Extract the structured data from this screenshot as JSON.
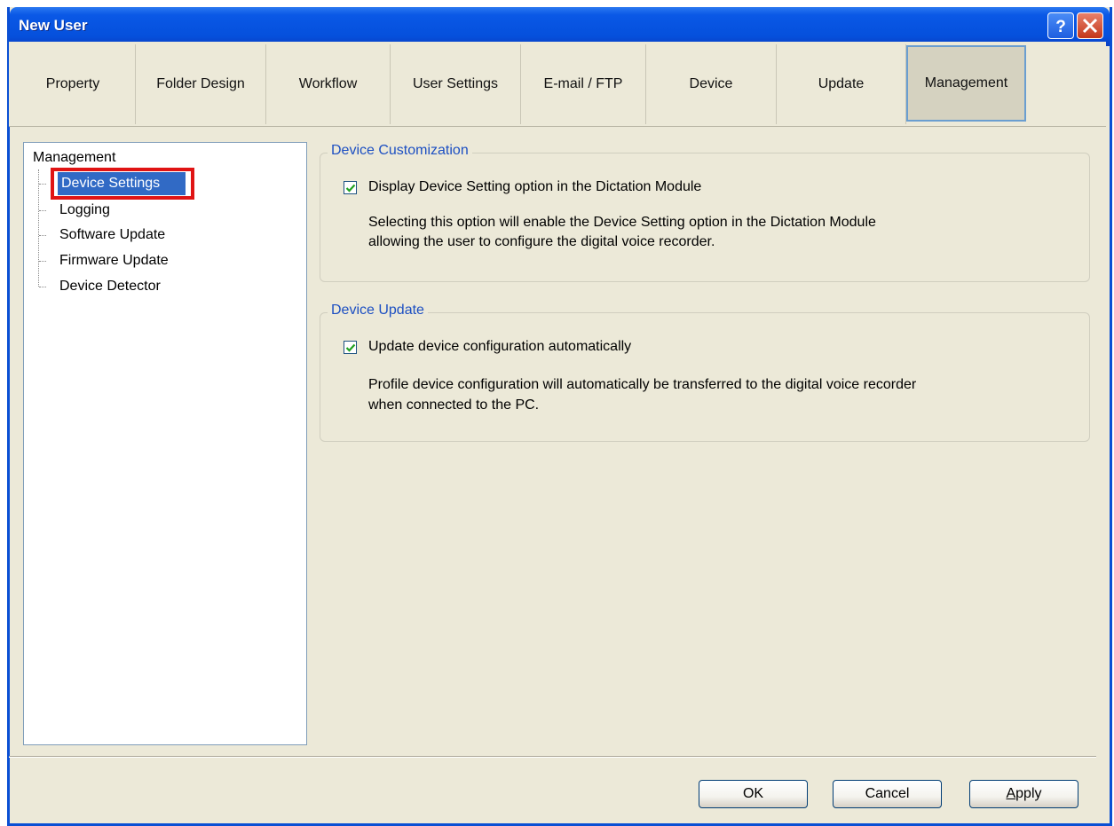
{
  "window": {
    "title": "New User",
    "help_label": "?",
    "close_label": "X"
  },
  "tabs": [
    {
      "label": "Property"
    },
    {
      "label": "Folder Design"
    },
    {
      "label": "Workflow"
    },
    {
      "label": "User Settings"
    },
    {
      "label": "E-mail / FTP"
    },
    {
      "label": "Device"
    },
    {
      "label": "Update"
    },
    {
      "label": "Management",
      "active": true
    }
  ],
  "tree": {
    "root": "Management",
    "items": [
      {
        "label": "Device Settings",
        "selected": true
      },
      {
        "label": "Logging"
      },
      {
        "label": "Software Update"
      },
      {
        "label": "Firmware Update"
      },
      {
        "label": "Device Detector"
      }
    ]
  },
  "device_customization": {
    "title": "Device Customization",
    "option_label": "Display Device Setting option in the Dictation Module",
    "checked": true,
    "desc_line1": "Selecting this option will enable the Device Setting option in the Dictation Module",
    "desc_line2": "allowing the user to configure the digital voice recorder."
  },
  "device_update": {
    "title": "Device Update",
    "option_label": "Update device configuration automatically",
    "checked": true,
    "desc_line1": "Profile device configuration will automatically be transferred to the digital voice recorder",
    "desc_line2": "when connected to the PC."
  },
  "buttons": {
    "ok": "OK",
    "cancel": "Cancel",
    "apply": "Apply"
  },
  "colors": {
    "titlebar": "#0550dc",
    "selection": "#316ac5",
    "group_title": "#1c4fc2",
    "highlight_box": "#e01414"
  }
}
